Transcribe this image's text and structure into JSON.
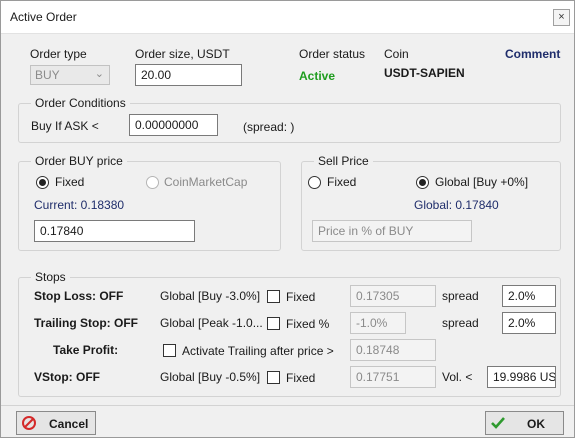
{
  "window": {
    "title": "Active Order",
    "close_glyph": "×"
  },
  "header": {
    "order_type_label": "Order type",
    "order_type_value": "BUY",
    "order_size_label": "Order size, USDT",
    "order_size_value": "20.00",
    "order_status_label": "Order status",
    "order_status_value": "Active",
    "coin_label": "Coin",
    "coin_value": "USDT-SAPIEN",
    "comment_label": "Comment"
  },
  "conditions": {
    "title": "Order Conditions",
    "buy_if_label": "Buy If ASK <",
    "buy_if_value": "0.00000000",
    "spread_text": "(spread: )"
  },
  "buy_price": {
    "title": "Order BUY price",
    "fixed_label": "Fixed",
    "cmc_label": "CoinMarketCap",
    "current_text": "Current: 0.18380",
    "price_value": "0.17840"
  },
  "sell_price": {
    "title": "Sell Price",
    "fixed_label": "Fixed",
    "global_label": "Global [Buy +0%]",
    "global_text": "Global: 0.17840",
    "placeholder": "Price in % of BUY"
  },
  "stops": {
    "title": "Stops",
    "stop_loss": {
      "label": "Stop Loss: OFF",
      "global": "Global [Buy -3.0%]",
      "fixed_label": "Fixed",
      "value": "0.17305",
      "spread_label": "spread",
      "spread_value": "2.0%"
    },
    "trailing": {
      "label": "Trailing Stop: OFF",
      "global": "Global [Peak -1.0...",
      "fixed_label": "Fixed %",
      "value": "-1.0%",
      "spread_label": "spread",
      "spread_value": "2.0%"
    },
    "take_profit": {
      "label": "Take Profit:",
      "activate_label": "Activate Trailing after price >",
      "value": "0.18748"
    },
    "vstop": {
      "label": "VStop: OFF",
      "global": "Global [Buy -0.5%]",
      "fixed_label": "Fixed",
      "value": "0.17751",
      "vol_label": "Vol. <",
      "vol_value": "19.9986 US"
    }
  },
  "footer": {
    "cancel_label": "Cancel",
    "ok_label": "OK"
  },
  "icons": {
    "cancel": "cancel-icon",
    "ok": "checkmark-icon",
    "dropdown": "chevron-down-icon",
    "close": "close-icon"
  },
  "colors": {
    "status_active": "#1f9d1f",
    "comment": "#1f2d6b",
    "cancel_icon": "#d42a2a",
    "ok_icon": "#2f9a2f"
  }
}
